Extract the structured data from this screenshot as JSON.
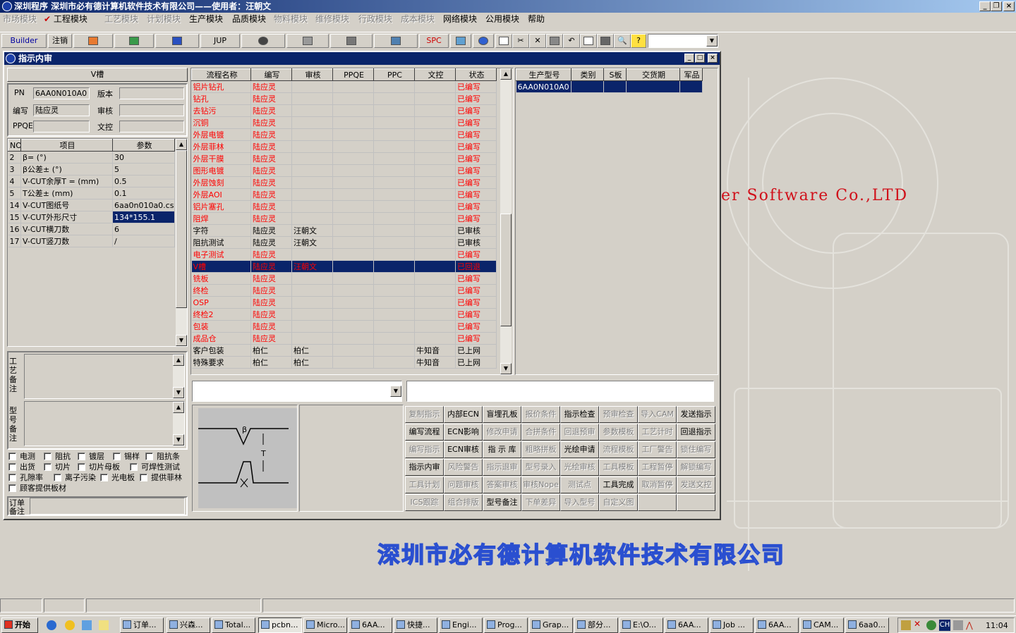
{
  "app": {
    "title": "深圳程序    深圳市必有德计算机软件技术有限公司——使用者：汪朝文",
    "menu": [
      {
        "label": "市场模块",
        "enabled": false
      },
      {
        "label": "工程模块",
        "enabled": true,
        "checked": true
      },
      {
        "label": "工艺模块",
        "enabled": false
      },
      {
        "label": "计划模块",
        "enabled": false
      },
      {
        "label": "生产模块",
        "enabled": true
      },
      {
        "label": "品质模块",
        "enabled": true
      },
      {
        "label": "物料模块",
        "enabled": false
      },
      {
        "label": "维修模块",
        "enabled": false
      },
      {
        "label": "行政模块",
        "enabled": false
      },
      {
        "label": "成本模块",
        "enabled": false
      },
      {
        "label": "网络模块",
        "enabled": true
      },
      {
        "label": "公用模块",
        "enabled": true
      },
      {
        "label": "帮助",
        "enabled": true
      }
    ],
    "toolbar": {
      "builder": "Builder",
      "logout": "注销",
      "jup": "JUP",
      "spc": "SPC"
    }
  },
  "window": {
    "title": "指示内审",
    "header_label": "V槽",
    "form": {
      "pn_label": "PN",
      "pn_value": "6AA0N010A0",
      "version_label": "版本",
      "version_value": "",
      "editor_label": "编写",
      "editor_value": "陆应灵",
      "review_label": "审核",
      "review_value": "",
      "ppqe_label": "PPQE",
      "ppqe_value": "",
      "doc_label": "文控",
      "doc_value": ""
    },
    "params": {
      "headers": [
        "NO",
        "项目",
        "参数"
      ],
      "rows": [
        {
          "no": "2",
          "item": "β=  (°)",
          "value": "30"
        },
        {
          "no": "3",
          "item": "β公差±  (°)",
          "value": "5"
        },
        {
          "no": "4",
          "item": "V-CUT余厚T =  (mm)",
          "value": "0.5"
        },
        {
          "no": "5",
          "item": "T公差±  (mm)",
          "value": "0.1"
        },
        {
          "no": "14",
          "item": "V-CUT图纸号",
          "value": "6aa0n010a0.csv"
        },
        {
          "no": "15",
          "item": "V-CUT外形尺寸",
          "value": "134*155.1"
        },
        {
          "no": "16",
          "item": "V-CUT横刀数",
          "value": "6"
        },
        {
          "no": "17",
          "item": "V-CUT竖刀数",
          "value": "/"
        }
      ]
    },
    "notes": {
      "process_note_label": "工艺备注",
      "model_note_label": "型号备注",
      "order_note_label": "订单备注"
    },
    "checkboxes": [
      "电测",
      "阻抗",
      "镀层",
      "锡样",
      "阻抗条",
      "出货",
      "切片",
      "切片母板",
      "可焊性测试",
      "孔隙率",
      "离子污染",
      "光电板",
      "提供菲林",
      "顾客提供板材"
    ],
    "flow": {
      "headers": [
        "流程名称",
        "编写",
        "审核",
        "PPQE",
        "PPC",
        "文控",
        "状态"
      ],
      "rows": [
        {
          "name": "铝片钻孔",
          "editor": "陆应灵",
          "review": "",
          "ppqe": "",
          "ppc": "",
          "doc": "",
          "status": "已编写",
          "style": "red"
        },
        {
          "name": "钻孔",
          "editor": "陆应灵",
          "review": "",
          "ppqe": "",
          "ppc": "",
          "doc": "",
          "status": "已编写",
          "style": "red"
        },
        {
          "name": "去钻污",
          "editor": "陆应灵",
          "review": "",
          "ppqe": "",
          "ppc": "",
          "doc": "",
          "status": "已编写",
          "style": "red"
        },
        {
          "name": "沉铜",
          "editor": "陆应灵",
          "review": "",
          "ppqe": "",
          "ppc": "",
          "doc": "",
          "status": "已编写",
          "style": "red"
        },
        {
          "name": "外层电镀",
          "editor": "陆应灵",
          "review": "",
          "ppqe": "",
          "ppc": "",
          "doc": "",
          "status": "已编写",
          "style": "red"
        },
        {
          "name": "外层菲林",
          "editor": "陆应灵",
          "review": "",
          "ppqe": "",
          "ppc": "",
          "doc": "",
          "status": "已编写",
          "style": "red"
        },
        {
          "name": "外层干膜",
          "editor": "陆应灵",
          "review": "",
          "ppqe": "",
          "ppc": "",
          "doc": "",
          "status": "已编写",
          "style": "red"
        },
        {
          "name": "图形电镀",
          "editor": "陆应灵",
          "review": "",
          "ppqe": "",
          "ppc": "",
          "doc": "",
          "status": "已编写",
          "style": "red"
        },
        {
          "name": "外层蚀刻",
          "editor": "陆应灵",
          "review": "",
          "ppqe": "",
          "ppc": "",
          "doc": "",
          "status": "已编写",
          "style": "red"
        },
        {
          "name": "外层AOI",
          "editor": "陆应灵",
          "review": "",
          "ppqe": "",
          "ppc": "",
          "doc": "",
          "status": "已编写",
          "style": "red"
        },
        {
          "name": "铝片塞孔",
          "editor": "陆应灵",
          "review": "",
          "ppqe": "",
          "ppc": "",
          "doc": "",
          "status": "已编写",
          "style": "red"
        },
        {
          "name": "阻焊",
          "editor": "陆应灵",
          "review": "",
          "ppqe": "",
          "ppc": "",
          "doc": "",
          "status": "已编写",
          "style": "red"
        },
        {
          "name": "字符",
          "editor": "陆应灵",
          "review": "汪朝文",
          "ppqe": "",
          "ppc": "",
          "doc": "",
          "status": "已审核",
          "style": "black"
        },
        {
          "name": "阻抗测试",
          "editor": "陆应灵",
          "review": "汪朝文",
          "ppqe": "",
          "ppc": "",
          "doc": "",
          "status": "已审核",
          "style": "black"
        },
        {
          "name": "电子测试",
          "editor": "陆应灵",
          "review": "",
          "ppqe": "",
          "ppc": "",
          "doc": "",
          "status": "已编写",
          "style": "red"
        },
        {
          "name": "V槽",
          "editor": "陆应灵",
          "review": "汪朝文",
          "ppqe": "",
          "ppc": "",
          "doc": "",
          "status": "已回退",
          "style": "selected"
        },
        {
          "name": "铣板",
          "editor": "陆应灵",
          "review": "",
          "ppqe": "",
          "ppc": "",
          "doc": "",
          "status": "已编写",
          "style": "red"
        },
        {
          "name": "终检",
          "editor": "陆应灵",
          "review": "",
          "ppqe": "",
          "ppc": "",
          "doc": "",
          "status": "已编写",
          "style": "red"
        },
        {
          "name": "OSP",
          "editor": "陆应灵",
          "review": "",
          "ppqe": "",
          "ppc": "",
          "doc": "",
          "status": "已编写",
          "style": "red"
        },
        {
          "name": "终检2",
          "editor": "陆应灵",
          "review": "",
          "ppqe": "",
          "ppc": "",
          "doc": "",
          "status": "已编写",
          "style": "red"
        },
        {
          "name": "包装",
          "editor": "陆应灵",
          "review": "",
          "ppqe": "",
          "ppc": "",
          "doc": "",
          "status": "已编写",
          "style": "red"
        },
        {
          "name": "成品仓",
          "editor": "陆应灵",
          "review": "",
          "ppqe": "",
          "ppc": "",
          "doc": "",
          "status": "已编写",
          "style": "red"
        },
        {
          "name": "客户包装",
          "editor": "柏仁",
          "review": "柏仁",
          "ppqe": "",
          "ppc": "",
          "doc": "牛知音",
          "status": "已上网",
          "style": "black"
        },
        {
          "name": "特殊要求",
          "editor": "柏仁",
          "review": "柏仁",
          "ppqe": "",
          "ppc": "",
          "doc": "牛知音",
          "status": "已上网",
          "style": "black"
        }
      ]
    },
    "models": {
      "headers": [
        "生产型号",
        "类别",
        "S板",
        "交货期",
        "军品"
      ],
      "rows": [
        {
          "model": "6AA0N010A0",
          "type": "",
          "s": "",
          "due": "",
          "mil": ""
        }
      ]
    },
    "buttons": [
      [
        {
          "label": "复制指示",
          "enabled": false
        },
        {
          "label": "内部ECN",
          "enabled": true
        },
        {
          "label": "盲埋孔板",
          "enabled": true
        },
        {
          "label": "报价条件",
          "enabled": false
        },
        {
          "label": "指示检查",
          "enabled": true
        },
        {
          "label": "预审检查",
          "enabled": false
        },
        {
          "label": "导入CAM",
          "enabled": false
        },
        {
          "label": "发送指示",
          "enabled": true
        }
      ],
      [
        {
          "label": "编写流程",
          "enabled": true
        },
        {
          "label": "ECN影响",
          "enabled": true
        },
        {
          "label": "修改申请",
          "enabled": false
        },
        {
          "label": "合拼条件",
          "enabled": false
        },
        {
          "label": "回退预审",
          "enabled": false
        },
        {
          "label": "参数模板",
          "enabled": false
        },
        {
          "label": "工艺计时",
          "enabled": false
        },
        {
          "label": "回退指示",
          "enabled": true
        }
      ],
      [
        {
          "label": "编写指示",
          "enabled": false
        },
        {
          "label": "ECN审核",
          "enabled": true
        },
        {
          "label": "指 示 库",
          "enabled": true
        },
        {
          "label": "粗略拼板",
          "enabled": false
        },
        {
          "label": "光绘申请",
          "enabled": true
        },
        {
          "label": "流程模板",
          "enabled": false
        },
        {
          "label": "工厂警告",
          "enabled": false
        },
        {
          "label": "锁住编写",
          "enabled": false
        }
      ],
      [
        {
          "label": "指示内审",
          "enabled": true
        },
        {
          "label": "风险警告",
          "enabled": false
        },
        {
          "label": "指示退审",
          "enabled": false
        },
        {
          "label": "型号录入",
          "enabled": false
        },
        {
          "label": "光绘审核",
          "enabled": false
        },
        {
          "label": "工具模板",
          "enabled": false
        },
        {
          "label": "工程暂停",
          "enabled": false
        },
        {
          "label": "解锁编写",
          "enabled": false
        }
      ],
      [
        {
          "label": "工具计划",
          "enabled": false
        },
        {
          "label": "问题审核",
          "enabled": false
        },
        {
          "label": "答案审核",
          "enabled": false
        },
        {
          "label": "审核Nope",
          "enabled": false
        },
        {
          "label": "测试点",
          "enabled": false
        },
        {
          "label": "工具完成",
          "enabled": true
        },
        {
          "label": "取消暂停",
          "enabled": false
        },
        {
          "label": "发送文控",
          "enabled": false
        }
      ],
      [
        {
          "label": "ICS跟踪",
          "enabled": false
        },
        {
          "label": "组合排版",
          "enabled": false
        },
        {
          "label": "型号备注",
          "enabled": true
        },
        {
          "label": "下单差异",
          "enabled": false
        },
        {
          "label": "导入型号",
          "enabled": false
        },
        {
          "label": "自定义图",
          "enabled": false
        },
        {
          "label": "",
          "enabled": false
        },
        {
          "label": "",
          "enabled": false
        }
      ]
    ],
    "diagram": {
      "beta": "β",
      "t": "T"
    }
  },
  "background": {
    "software_text": "er  Software  Co.,LTD",
    "company_text": "深圳市必有德计算机软件技术有限公司"
  },
  "taskbar": {
    "start": "开始",
    "tasks": [
      "订单...",
      "兴森...",
      "Total...",
      "pcbn...",
      "Micro...",
      "6AA...",
      "快捷...",
      "Engi...",
      "Prog...",
      "Grap...",
      "部分...",
      "E:\\O...",
      "6AA...",
      "Job ...",
      "6AA...",
      "CAM...",
      "6aa0..."
    ],
    "clock": "11:04",
    "lang": "CH"
  },
  "colors": {
    "titlebar": "#0a246a",
    "red_text": "#ff0000",
    "selection": "#0a246a"
  }
}
